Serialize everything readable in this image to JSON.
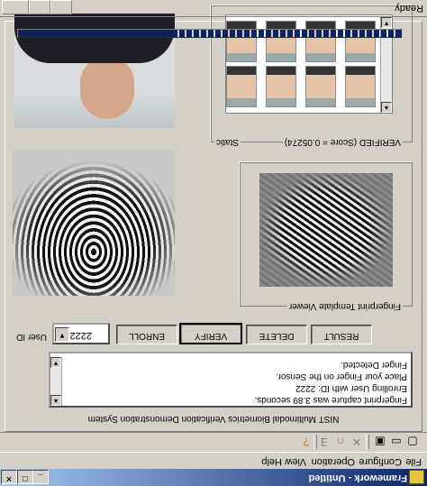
{
  "window": {
    "title": "Framework - Untitled"
  },
  "title_buttons": [
    "_",
    "□",
    "×"
  ],
  "menu": [
    "File",
    "Configure",
    "Operation",
    "View",
    "Help"
  ],
  "toolbar": [
    "new-icon",
    "open-icon",
    "save-icon",
    "cut-icon",
    "copy-icon",
    "paste-icon",
    "about-icon"
  ],
  "system_title": "NIST Multimodal Biometrics Verification Demonstration System",
  "log": [
    "Fingerprint capture was 3.89 seconds.",
    "Enrolling User with ID: 2222",
    "Place your Finger on the Sensor.",
    "Finger Detected."
  ],
  "user_id": {
    "label": "User ID",
    "value": "2222"
  },
  "buttons": {
    "enroll": "ENROLL",
    "verify": "VERIFY",
    "delete": "DELETE",
    "result": "RESULT"
  },
  "panels": {
    "template_viewer": "Fingerprint Template Viewer",
    "static": "Static",
    "verified": "VERIFIED (Score = 0.05274)"
  },
  "progress": {
    "value": 1.0
  },
  "status": {
    "text": "Ready"
  }
}
